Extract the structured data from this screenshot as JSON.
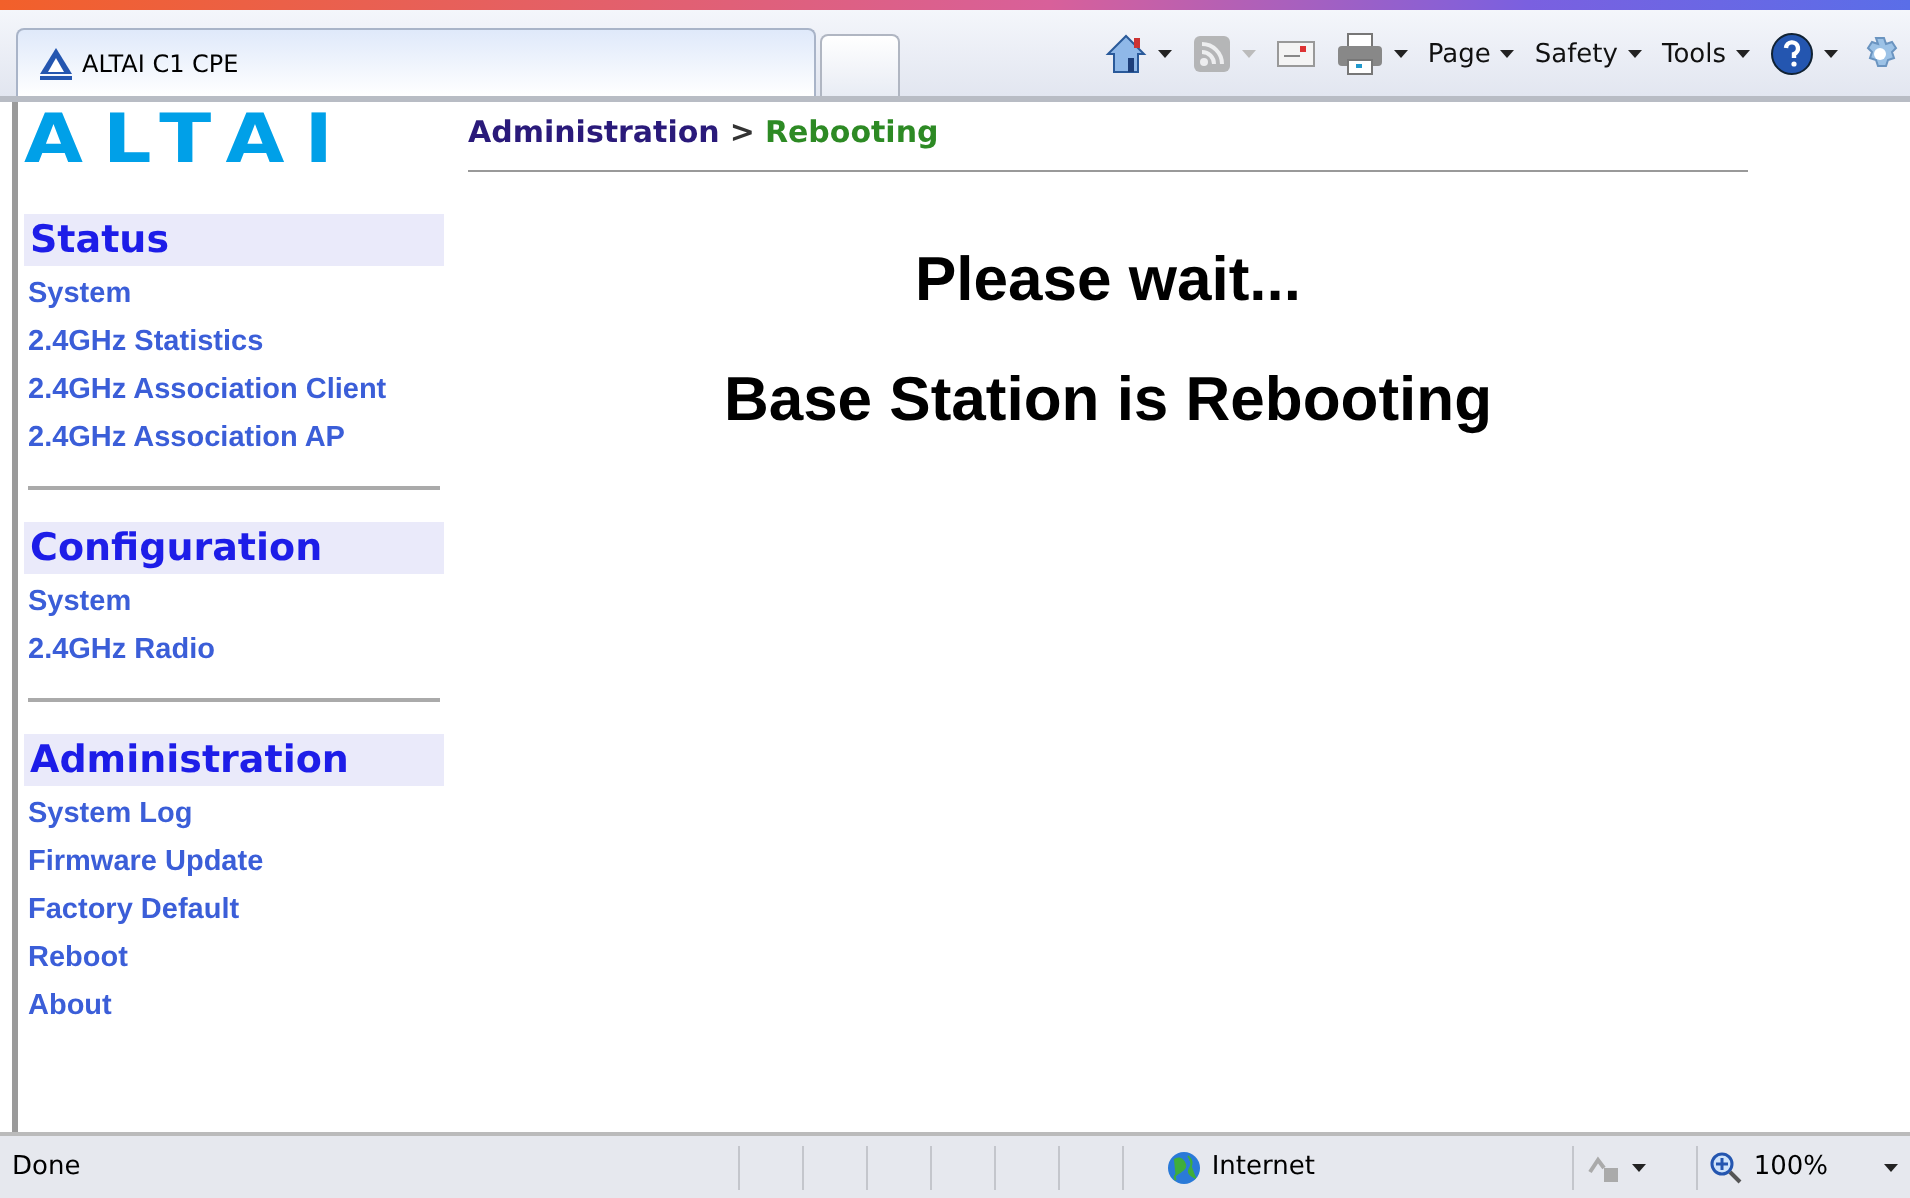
{
  "browser": {
    "tab_title": "ALTAI C1 CPE",
    "toolbar": [
      {
        "kind": "home",
        "dropdown": true,
        "disabled": false
      },
      {
        "kind": "feed",
        "dropdown": true,
        "disabled": true
      },
      {
        "kind": "mail",
        "dropdown": false,
        "disabled": false
      },
      {
        "kind": "print",
        "dropdown": true,
        "disabled": false
      },
      {
        "kind": "menu",
        "label": "Page"
      },
      {
        "kind": "menu",
        "label": "Safety"
      },
      {
        "kind": "menu",
        "label": "Tools"
      },
      {
        "kind": "help",
        "dropdown": true,
        "disabled": false
      },
      {
        "kind": "gear",
        "dropdown": false,
        "disabled": false
      }
    ]
  },
  "logo": "ALTAI",
  "breadcrumb": {
    "parent": "Administration",
    "separator": ">",
    "current": "Rebooting"
  },
  "sidebar": [
    {
      "heading": "Status",
      "items": [
        "System",
        "2.4GHz Statistics",
        "2.4GHz Association Client",
        "2.4GHz Association AP"
      ]
    },
    {
      "heading": "Configuration",
      "items": [
        "System",
        "2.4GHz Radio"
      ]
    },
    {
      "heading": "Administration",
      "items": [
        "System Log",
        "Firmware Update",
        "Factory Default",
        "Reboot",
        "About"
      ]
    }
  ],
  "message": {
    "line_1": "Please wait...",
    "line_2": "Base Station is Rebooting"
  },
  "status_bar": {
    "status": "Done",
    "zone": "Internet",
    "zoom": "100%"
  }
}
